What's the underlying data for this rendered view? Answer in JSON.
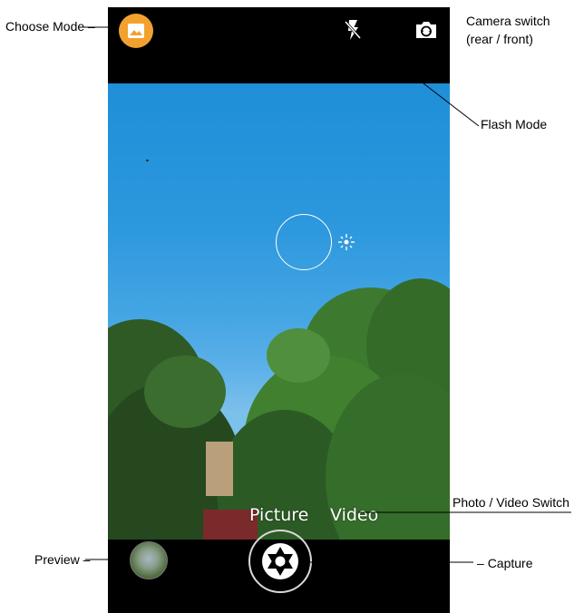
{
  "callouts": {
    "choose_mode": "Choose Mode",
    "camera_switch_line1": "Camera switch",
    "camera_switch_line2": "(rear / front)",
    "flash_mode": "Flash Mode",
    "photo_video_switch": "Photo / Video Switch",
    "preview": "Preview",
    "capture": "Capture"
  },
  "camera": {
    "modes": [
      "Picture",
      "Video"
    ],
    "icons": {
      "choose_mode": "image-icon",
      "flash": "flash-off-icon",
      "switch": "camera-switch-icon",
      "capture": "shutter-aperture-icon",
      "exposure": "brightness-icon"
    },
    "colors": {
      "accent": "#f2a12e",
      "bar": "#000000",
      "sky": "#2b97dd"
    }
  }
}
